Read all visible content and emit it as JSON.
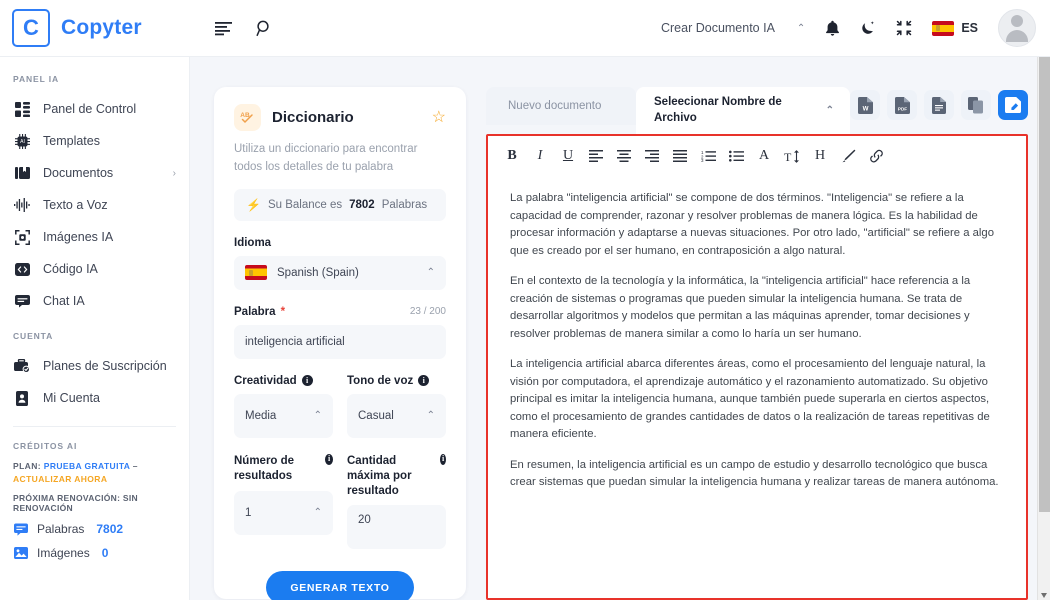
{
  "brand": {
    "logo_letter": "C",
    "name": "Copyter"
  },
  "topbar": {
    "menu_icon": "menu-lines-icon",
    "search_icon": "search-icon",
    "create_doc_label": "Crear Documento IA",
    "create_doc_caret": "⌃",
    "bell_icon": "bell-icon",
    "theme_icon": "moon-icon",
    "fullscreen_icon": "collapse-icon",
    "lang_code": "ES",
    "avatar": "user-avatar"
  },
  "sidebar": {
    "section_panel": "PANEL IA",
    "items": [
      {
        "label": "Panel de Control",
        "icon": "dashboard-icon"
      },
      {
        "label": "Templates",
        "icon": "chip-ai-icon"
      },
      {
        "label": "Documentos",
        "icon": "documents-icon",
        "chevron": "›"
      },
      {
        "label": "Texto a Voz",
        "icon": "waveform-icon"
      },
      {
        "label": "Imágenes IA",
        "icon": "image-frame-icon"
      },
      {
        "label": "Código IA",
        "icon": "code-icon"
      },
      {
        "label": "Chat IA",
        "icon": "chat-icon"
      }
    ],
    "section_account": "CUENTA",
    "account_items": [
      {
        "label": "Planes de Suscripción",
        "icon": "briefcase-check-icon"
      },
      {
        "label": "Mi Cuenta",
        "icon": "id-card-icon"
      }
    ],
    "section_credits": "CRÉDITOS AI",
    "plan_prefix": "PLAN:",
    "plan_name": "PRUEBA GRATUITA",
    "plan_dash": "–",
    "plan_upgrade": "ACTUALIZAR AHORA",
    "renewal": "PRÓXIMA RENOVACIÓN: SIN RENOVACIÓN",
    "credits": [
      {
        "label": "Palabras",
        "value": "7802",
        "icon": "chat-bubble-icon"
      },
      {
        "label": "Imágenes",
        "value": "0",
        "icon": "image-icon"
      }
    ]
  },
  "form_card": {
    "badge": "AB",
    "title": "Diccionario",
    "star_icon": "star-outline-icon",
    "subtitle": "Utiliza un diccionario para encontrar todos los detalles de tu palabra",
    "balance_bolt": "⚡",
    "balance_prefix": "Su Balance es",
    "balance_value": "7802",
    "balance_suffix": "Palabras",
    "idioma_label": "Idioma",
    "idioma_value": "Spanish (Spain)",
    "palabra_label": "Palabra",
    "palabra_required": "*",
    "palabra_counter": "23 / 200",
    "palabra_value": "inteligencia artificial",
    "creatividad_label": "Creatividad",
    "creatividad_value": "Media",
    "tono_label": "Tono de voz",
    "tono_value": "Casual",
    "numero_label": "Número de resultados",
    "numero_value": "1",
    "cantidad_label": "Cantidad máxima por resultado",
    "cantidad_value": "20",
    "generate_button": "GENERAR TEXTO"
  },
  "editor": {
    "tab_new": "Nuevo documento",
    "tab_select": "Seleecionar Nombre de Archivo",
    "tab_select_caret": "⌃",
    "export_buttons": [
      {
        "name": "export-word-button",
        "glyph": "W"
      },
      {
        "name": "export-pdf-button",
        "glyph": "PDF"
      },
      {
        "name": "export-text-button",
        "glyph": "≡"
      },
      {
        "name": "copy-button",
        "glyph": "❐"
      },
      {
        "name": "save-document-button",
        "glyph": "💾"
      }
    ],
    "toolbar": [
      {
        "name": "bold-icon",
        "glyph": "B"
      },
      {
        "name": "italic-icon",
        "glyph": "I"
      },
      {
        "name": "underline-icon",
        "glyph": "U"
      },
      {
        "name": "align-left-icon",
        "glyph": "≡"
      },
      {
        "name": "align-center-icon",
        "glyph": "≡"
      },
      {
        "name": "align-right-icon",
        "glyph": "≡"
      },
      {
        "name": "align-justify-icon",
        "glyph": "≡"
      },
      {
        "name": "ordered-list-icon",
        "glyph": "1≡"
      },
      {
        "name": "bullet-list-icon",
        "glyph": "•≡"
      },
      {
        "name": "font-family-icon",
        "glyph": "A"
      },
      {
        "name": "font-size-icon",
        "glyph": "T↕"
      },
      {
        "name": "heading-icon",
        "glyph": "H"
      },
      {
        "name": "highlight-icon",
        "glyph": "✎"
      },
      {
        "name": "link-icon",
        "glyph": "🔗"
      }
    ],
    "paragraphs": [
      "La palabra \"inteligencia artificial\" se compone de dos términos. \"Inteligencia\" se refiere a la capacidad de comprender, razonar y resolver problemas de manera lógica. Es la habilidad de procesar información y adaptarse a nuevas situaciones. Por otro lado, \"artificial\" se refiere a algo que es creado por el ser humano, en contraposición a algo natural.",
      "En el contexto de la tecnología y la informática, la \"inteligencia artificial\" hace referencia a la creación de sistemas o programas que pueden simular la inteligencia humana. Se trata de desarrollar algoritmos y modelos que permitan a las máquinas aprender, tomar decisiones y resolver problemas de manera similar a como lo haría un ser humano.",
      "La inteligencia artificial abarca diferentes áreas, como el procesamiento del lenguaje natural, la visión por computadora, el aprendizaje automático y el razonamiento automatizado. Su objetivo principal es imitar la inteligencia humana, aunque también puede superarla en ciertos aspectos, como el procesamiento de grandes cantidades de datos o la realización de tareas repetitivas de manera eficiente.",
      "En resumen, la inteligencia artificial es un campo de estudio y desarrollo tecnológico que busca crear sistemas que puedan simular la inteligencia humana y realizar tareas de manera autónoma."
    ]
  },
  "colors": {
    "accent_blue": "#2f7df6",
    "orange": "#f5a623",
    "editor_border_red": "#e8322a",
    "page_bg": "#f4f6fa"
  }
}
